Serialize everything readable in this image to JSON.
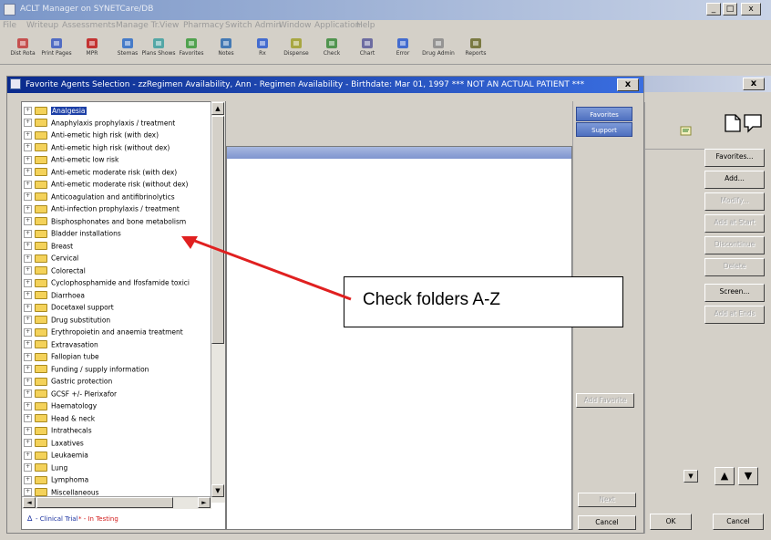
{
  "app": {
    "title": "ACLT Manager on SYNETCare/DB",
    "win_min": "_",
    "win_max": "□",
    "win_close": "x",
    "menu": [
      "File",
      "Writeup",
      "Assessments",
      "Manage Tr.",
      "View",
      "Pharmacy",
      "Switch Admin",
      "Window",
      "Application",
      "Help"
    ],
    "toolbar": [
      {
        "label": "Dist Rota",
        "icon": "star-icon",
        "color": "#c23a3a"
      },
      {
        "label": "Print Pages",
        "icon": "rx-icon",
        "color": "#3a5bc2"
      },
      {
        "label": "MPR",
        "icon": "pill-icon",
        "color": "#c01818"
      },
      {
        "label": "Stemas",
        "icon": "chart-icon",
        "color": "#2d6cc8"
      },
      {
        "label": "Plans Shows",
        "icon": "grid-icon",
        "color": "#3da0a0"
      },
      {
        "label": "Favorites",
        "icon": "house-icon",
        "color": "#3a9a3a"
      },
      {
        "label": "Notes",
        "icon": "gear-icon",
        "color": "#2a6ab0"
      },
      {
        "label": "Rx",
        "icon": "rx-icon",
        "color": "#2a5ad0"
      },
      {
        "label": "Dispense",
        "icon": "box-icon",
        "color": "#a0a02a"
      },
      {
        "label": "Check",
        "icon": "check-icon",
        "color": "#3a8a3a"
      },
      {
        "label": "Chart",
        "icon": "doc-icon",
        "color": "#5a5a9a"
      },
      {
        "label": "Error",
        "icon": "warn-icon",
        "color": "#2a5ad0"
      },
      {
        "label": "Drug Admin",
        "icon": "pen-icon",
        "color": "#8a8a8a"
      },
      {
        "label": "Reports",
        "icon": "report-icon",
        "color": "#6a6a2a"
      }
    ]
  },
  "dialog": {
    "title": "Favorite Agents Selection - zzRegimen Availability, Ann - Regimen Availability - Birthdate: Mar 01, 1997 *** NOT AN ACTUAL PATIENT ***",
    "close": "x",
    "tree_items": [
      "Analgesia",
      "Anaphylaxis prophylaxis / treatment",
      "Anti-emetic high risk (with dex)",
      "Anti-emetic high risk (without dex)",
      "Anti-emetic low risk",
      "Anti-emetic moderate risk (with dex)",
      "Anti-emetic moderate risk (without dex)",
      "Anticoagulation and antifibrinolytics",
      "Anti-infection prophylaxis / treatment",
      "Bisphosphonates and bone metabolism",
      "Bladder installations",
      "Breast",
      "Cervical",
      "Colorectal",
      "Cyclophosphamide and Ifosfamide toxici",
      "Diarrhoea",
      "Docetaxel support",
      "Drug substitution",
      "Erythropoietin and anaemia treatment",
      "Extravasation",
      "Fallopian tube",
      "Funding / supply information",
      "Gastric protection",
      "GCSF +/- Plerixafor",
      "Haematology",
      "Head & neck",
      "Intrathecals",
      "Laxatives",
      "Leukaemia",
      "Lung",
      "Lymphoma",
      "Miscellaneous"
    ],
    "expander": "+",
    "legend_trial": "- Clinical Trial",
    "legend_testing": "* - In Testing",
    "tabs": [
      "Favorites",
      "Support"
    ],
    "btn_add_favorite": "Add Favorite",
    "btn_next": "Next",
    "btn_cancel": "Cancel"
  },
  "background_window": {
    "close": "x",
    "buttons": [
      "Favorites...",
      "Add...",
      "Modify...",
      "Add at Start",
      "Discontinue",
      "Delete",
      "Screen...",
      "Add at Ends"
    ],
    "buttons_enabled": [
      true,
      true,
      false,
      false,
      false,
      false,
      true,
      false
    ],
    "ok": "OK",
    "cancel": "Cancel",
    "up_arrow": "▲",
    "down_arrow": "▼"
  },
  "callout": {
    "text": "Check folders A-Z",
    "arrow_color": "#e02020"
  }
}
